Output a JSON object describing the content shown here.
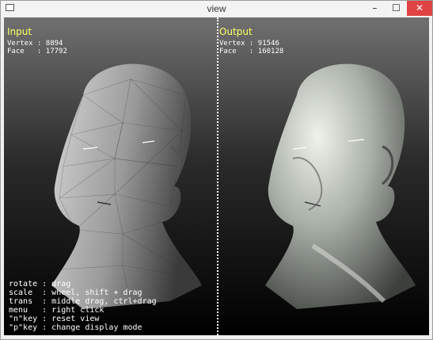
{
  "window": {
    "title": "view",
    "minimize": "–",
    "maximize": "☐",
    "close": "✕"
  },
  "input_panel": {
    "title": "Input",
    "vertex_label": "Vertex : ",
    "vertex": "8894",
    "face_label": "Face   : ",
    "face": "17792"
  },
  "output_panel": {
    "title": "Output",
    "vertex_label": "Vertex : ",
    "vertex": "91546",
    "face_label": "Face   : ",
    "face": "160128"
  },
  "help": [
    "rotate : drag",
    "scale  : wheel, shift + drag",
    "trans  : middle drag, ctrl+drag",
    "menu   : right click",
    "\"n\"key : reset view",
    "\"p\"key : change display mode"
  ],
  "colors": {
    "panel_title": "#ffff66",
    "close_button": "#e04343"
  }
}
